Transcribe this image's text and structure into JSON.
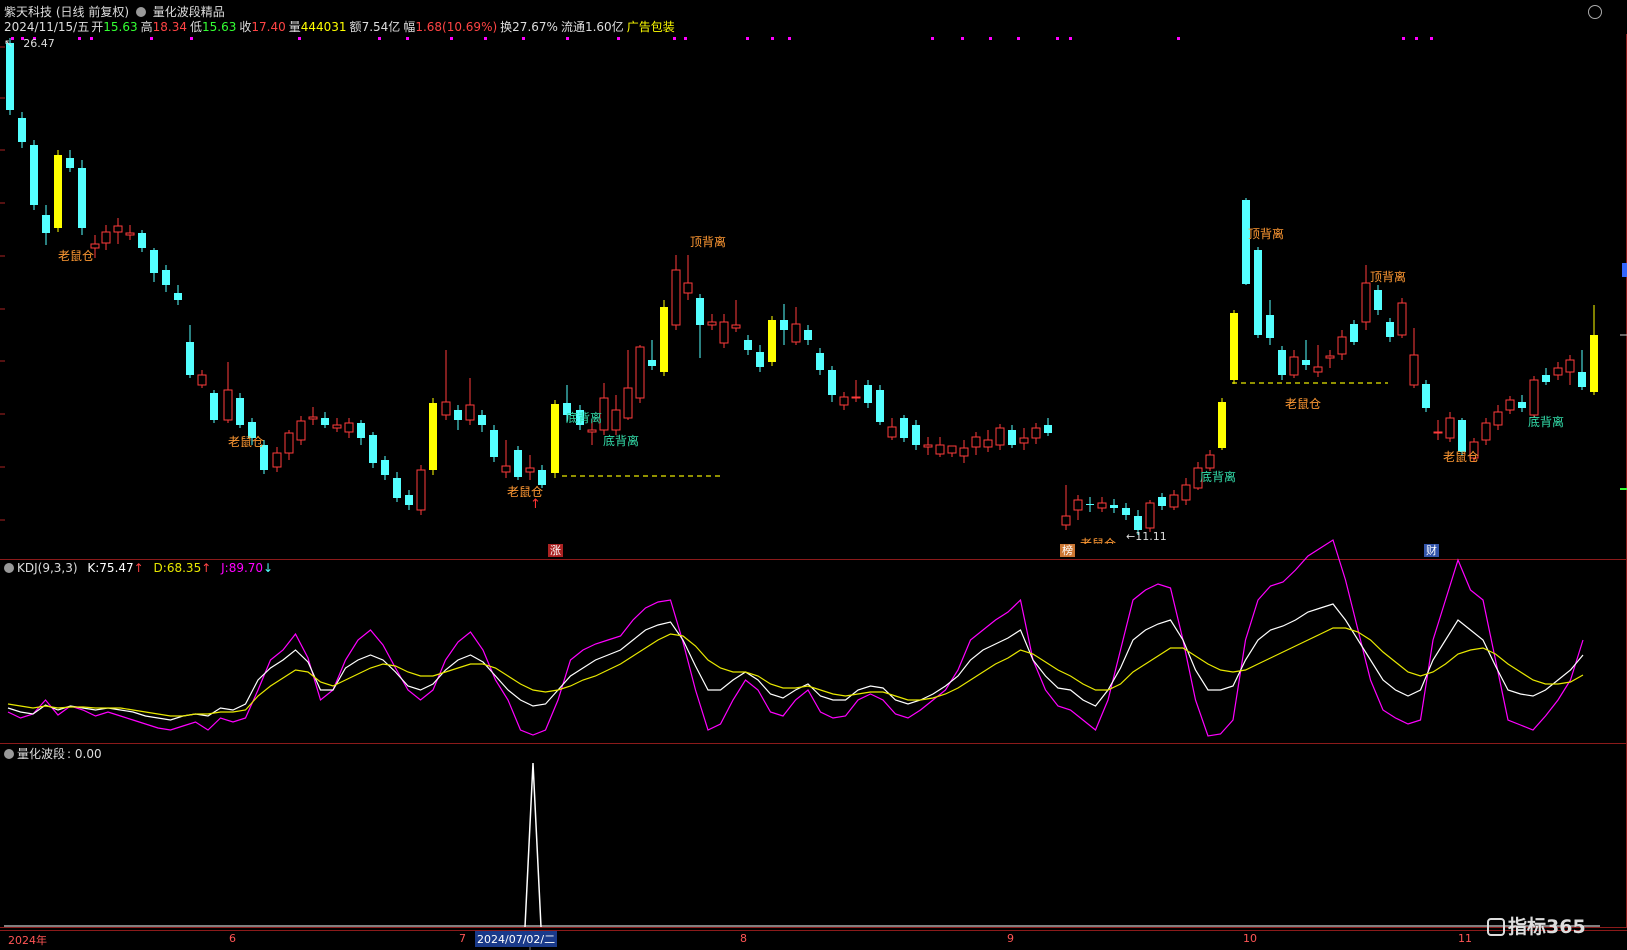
{
  "header": {
    "stock_name": "紫天科技",
    "period": "(日线 前复权)",
    "indicator_name": "量化波段精品",
    "date": "2024/11/15/五",
    "open_label": "开",
    "open": "15.63",
    "high_label": "高",
    "high": "18.34",
    "low_label": "低",
    "low": "15.63",
    "close_label": "收",
    "close": "17.40",
    "volume_label": "量",
    "volume": "444031",
    "amount_label": "额",
    "amount": "7.54亿",
    "change_label": "幅",
    "change": "1.68(10.69%)",
    "turnover_label": "换",
    "turnover": "27.67%",
    "float_label": "流通",
    "float": "1.60亿",
    "ad_label": "广告包装"
  },
  "main_chart": {
    "high_marker": "26.47",
    "low_marker": "11.11",
    "annotations": {
      "laoshucang": "老鼠仓",
      "dibeili": "底背离",
      "dingbeili": "顶背离"
    },
    "badges": {
      "zhang": "涨",
      "bang": "榜",
      "cai": "财"
    }
  },
  "kdj_panel": {
    "title": "KDJ(9,3,3)",
    "k_label": "K:",
    "k_value": "75.47",
    "d_label": "D:",
    "d_value": "68.35",
    "j_label": "J:",
    "j_value": "89.70",
    "k_arrow": "↑",
    "d_arrow": "↑",
    "j_arrow": "↓",
    "colors": {
      "k": "#ffffff",
      "d": "#e8e800",
      "j": "#ff00ff"
    }
  },
  "wave_panel": {
    "title": "量化波段",
    "value_label": ": 0.00"
  },
  "xaxis": {
    "labels": [
      "2024年",
      "6",
      "7",
      "8",
      "9",
      "10",
      "11"
    ],
    "cursor_date": "2024/07/02/二"
  },
  "watermark": {
    "text": "指标365"
  },
  "colors": {
    "up": "#ff3b3b",
    "down": "#54ffff",
    "highlight": "#ffff00",
    "annotation_orange": "#ff9933",
    "annotation_green": "#33ddaa",
    "frame": "#8b1a1a",
    "dots": "#ff00ff"
  }
}
